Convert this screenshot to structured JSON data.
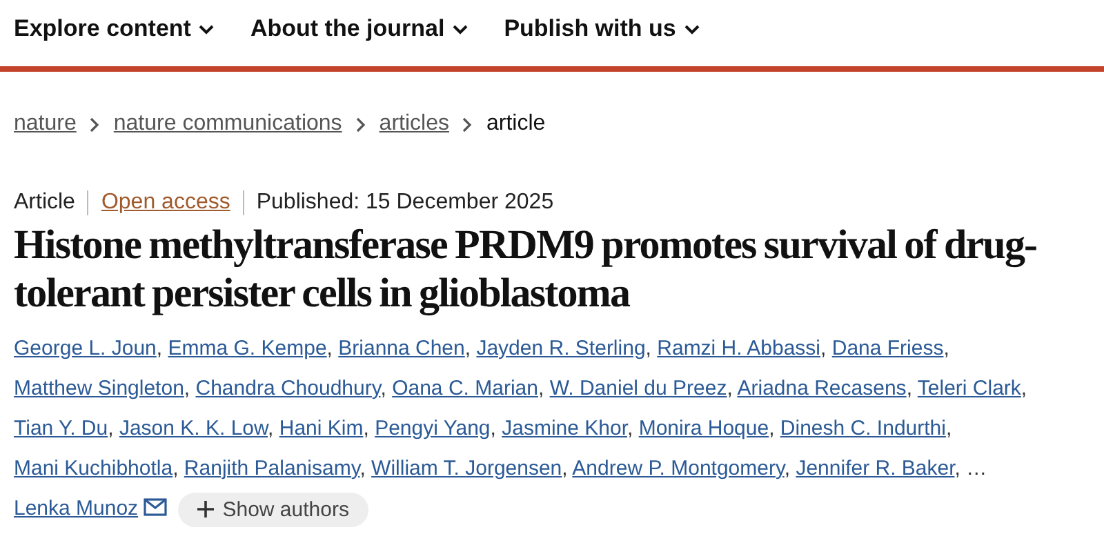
{
  "nav": [
    {
      "label": "Explore content"
    },
    {
      "label": "About the journal"
    },
    {
      "label": "Publish with us"
    }
  ],
  "breadcrumb": [
    {
      "label": "nature",
      "link": true
    },
    {
      "label": "nature communications",
      "link": true
    },
    {
      "label": "articles",
      "link": true
    },
    {
      "label": "article",
      "link": false
    }
  ],
  "meta": {
    "type": "Article",
    "access": "Open access",
    "published": "Published: 15 December 2025"
  },
  "title": "Histone methyltransferase PRDM9 promotes survival of drug-tolerant persister cells in glioblastoma",
  "authors": [
    {
      "name": "George L. Joun",
      "separator": ","
    },
    {
      "name": "Emma G. Kempe",
      "separator": ","
    },
    {
      "name": "Brianna Chen",
      "separator": ","
    },
    {
      "name": "Jayden R. Sterling",
      "separator": ","
    },
    {
      "name": "Ramzi H. Abbassi",
      "separator": ","
    },
    {
      "name": "Dana Friess",
      "separator": ","
    },
    {
      "name": "Matthew Singleton",
      "separator": ","
    },
    {
      "name": "Chandra Choudhury",
      "separator": ","
    },
    {
      "name": "Oana C. Marian",
      "separator": ","
    },
    {
      "name": "W. Daniel du Preez",
      "separator": ","
    },
    {
      "name": "Ariadna Recasens",
      "separator": ","
    },
    {
      "name": "Teleri Clark",
      "separator": ","
    },
    {
      "name": "Tian Y. Du",
      "separator": ","
    },
    {
      "name": "Jason K. K. Low",
      "separator": ","
    },
    {
      "name": "Hani Kim",
      "separator": ","
    },
    {
      "name": "Pengyi Yang",
      "separator": ","
    },
    {
      "name": "Jasmine Khor",
      "separator": ","
    },
    {
      "name": "Monira Hoque",
      "separator": ","
    },
    {
      "name": "Dinesh C. Indurthi",
      "separator": ","
    },
    {
      "name": "Mani Kuchibhotla",
      "separator": ","
    },
    {
      "name": "Ranjith Palanisamy",
      "separator": ","
    },
    {
      "name": "William T. Jorgensen",
      "separator": ","
    },
    {
      "name": "Andrew P. Montgomery",
      "separator": ","
    },
    {
      "name": "Jennifer R. Baker",
      "separator": ","
    }
  ],
  "ellipsis": "…",
  "corresponding_author": "Lenka Munoz",
  "show_authors": "Show authors"
}
